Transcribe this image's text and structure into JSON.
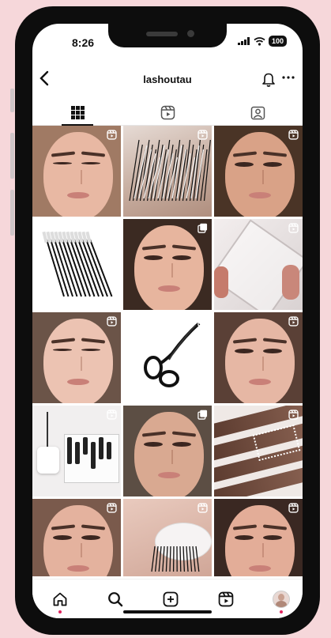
{
  "status": {
    "time": "8:26",
    "battery": "100"
  },
  "header": {
    "username": "lashoutau"
  },
  "tabs": [
    {
      "name": "posts-grid",
      "icon": "grid-icon",
      "active": true
    },
    {
      "name": "reels",
      "icon": "reels-icon",
      "active": false
    },
    {
      "name": "tagged",
      "icon": "tagged-person-icon",
      "active": false
    }
  ],
  "grid": {
    "tiles": [
      {
        "kind": "face",
        "skin": "#e8b8a3",
        "bg": "#a07a64",
        "badge": "reel",
        "eyes": "closed"
      },
      {
        "kind": "lashes",
        "bg": "#cdbcb2",
        "badge": "reel"
      },
      {
        "kind": "face",
        "skin": "#d9a287",
        "bg": "#4a3426",
        "badge": "reel",
        "eyes": "open"
      },
      {
        "kind": "brushes",
        "bg": "#ffffff",
        "badge": "none"
      },
      {
        "kind": "face",
        "skin": "#e7b59e",
        "bg": "#3b2a22",
        "badge": "carousel",
        "eyes": "open"
      },
      {
        "kind": "box",
        "bg": "#e9e4e4",
        "badge": "reel"
      },
      {
        "kind": "face",
        "skin": "#ecc3b2",
        "bg": "#6b5448",
        "badge": "reel",
        "eyes": "closed"
      },
      {
        "kind": "scissors",
        "bg": "#ffffff",
        "badge": "carousel"
      },
      {
        "kind": "face",
        "skin": "#e6b7a4",
        "bg": "#5a4036",
        "badge": "reel",
        "eyes": "open"
      },
      {
        "kind": "station",
        "bg": "#efeded",
        "badge": "reel"
      },
      {
        "kind": "face",
        "skin": "#d9a991",
        "bg": "#5c4e44",
        "badge": "carousel",
        "eyes": "open"
      },
      {
        "kind": "strips",
        "bg": "#6b4a3c",
        "badge": "reel"
      },
      {
        "kind": "face",
        "skin": "#e4b29e",
        "bg": "#7a5a4c",
        "badge": "reel",
        "eyes": "open"
      },
      {
        "kind": "lashpad",
        "bg": "#e2c1b4",
        "badge": "reel"
      },
      {
        "kind": "face",
        "skin": "#e3ad98",
        "bg": "#3a2822",
        "badge": "reel",
        "eyes": "open"
      }
    ]
  },
  "nav": [
    {
      "name": "home",
      "icon": "home-icon",
      "dot": true
    },
    {
      "name": "search",
      "icon": "search-icon",
      "dot": false
    },
    {
      "name": "create",
      "icon": "plus-square-icon",
      "dot": false
    },
    {
      "name": "reels",
      "icon": "reels-icon",
      "dot": false
    },
    {
      "name": "profile",
      "icon": "avatar-icon",
      "dot": true
    }
  ],
  "colors": {
    "background": "#f6d7da",
    "phone": "#0d0d0d",
    "notify": "#e0245e"
  }
}
